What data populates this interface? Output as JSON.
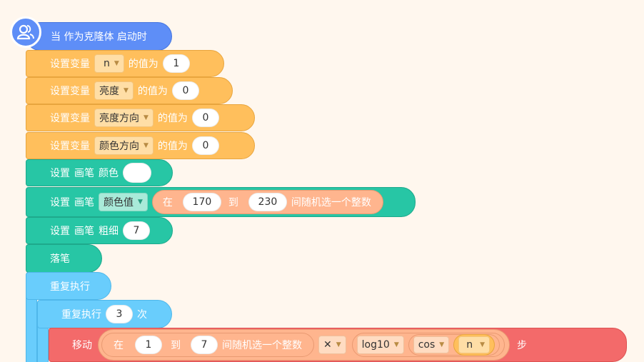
{
  "hat": {
    "label": "当 作为克隆体 启动时",
    "icon": "clone-user-icon"
  },
  "set_var_n": {
    "prefix": "设置变量",
    "var": "n",
    "mid": "的值为",
    "value": "1"
  },
  "set_var_brightness": {
    "prefix": "设置变量",
    "var": "亮度",
    "mid": "的值为",
    "value": "0"
  },
  "set_var_bright_dir": {
    "prefix": "设置变量",
    "var": "亮度方向",
    "mid": "的值为",
    "value": "0"
  },
  "set_var_color_dir": {
    "prefix": "设置变量",
    "var": "颜色方向",
    "mid": "的值为",
    "value": "0"
  },
  "set_pen_color": {
    "p1": "设置",
    "p2": "画笔",
    "p3": "颜色"
  },
  "set_pen_param": {
    "p1": "设置",
    "p2": "画笔",
    "param": "颜色值",
    "rand_from": "在",
    "min": "170",
    "rand_to": "到",
    "max": "230",
    "rand_suffix": "间随机选一个整数"
  },
  "set_pen_size": {
    "p1": "设置",
    "p2": "画笔",
    "p3": "粗细",
    "value": "7"
  },
  "pen_down": {
    "label": "落笔"
  },
  "forever": {
    "label": "重复执行"
  },
  "repeat": {
    "label": "重复执行",
    "times": "3",
    "suffix": "次"
  },
  "move": {
    "label": "移动",
    "rand_from": "在",
    "min": "1",
    "rand_to": "到",
    "max": "7",
    "rand_suffix": "间随机选一个整数",
    "operator": "✕",
    "func1": "log10",
    "func2": "cos",
    "var": "n",
    "suffix": "步"
  },
  "colors": {
    "events": "#5e8ef7",
    "variables": "#ffbf5c",
    "pen": "#27c6a5",
    "control": "#69cdfc",
    "motion": "#f36a6a",
    "operators": "#ffb58e"
  }
}
